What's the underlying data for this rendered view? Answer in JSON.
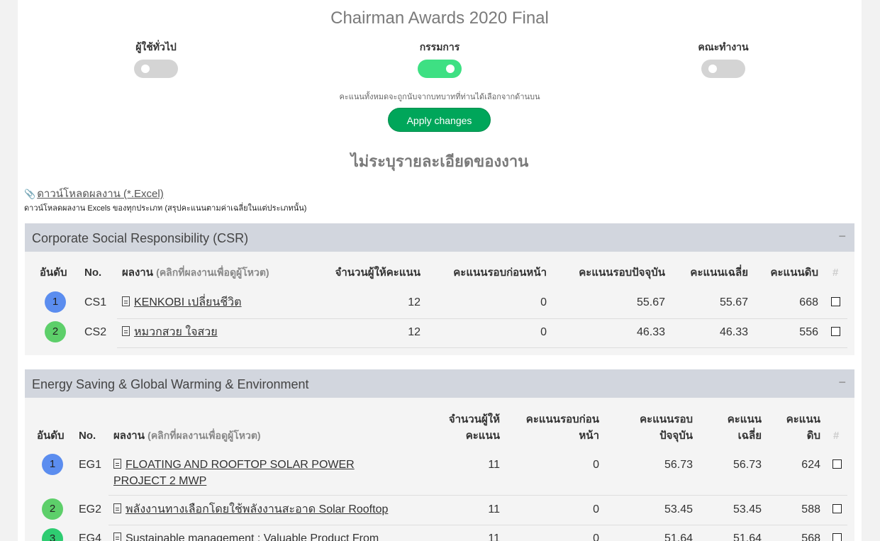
{
  "page": {
    "title": "Chairman Awards 2020 Final",
    "roles": [
      {
        "label": "ผู้ใช้ทั่วไป",
        "on": false
      },
      {
        "label": "กรรมการ",
        "on": true
      },
      {
        "label": "คณะทำงาน",
        "on": false
      }
    ],
    "hint": "คะแนนทั้งหมดจะถูกนับจากบทบาทที่ท่านได้เลือกจากด้านบน",
    "apply_label": "Apply changes",
    "subtitle": "ไม่ระบุรายละเอียดของงาน",
    "download_label": "ดาวน์โหลดผลงาน (*.Excel)",
    "download_desc": "ดาวน์โหลดผลงาน Excels ของทุกประเภท (สรุปคะแนนตามค่าเฉลี่ยในแต่ประเภทนั้น)"
  },
  "csr": {
    "title": "Corporate Social Responsibility (CSR)",
    "collapse": "−",
    "headers": {
      "rank": "อันดับ",
      "no": "No.",
      "work": "ผลงาน",
      "work_note": "(คลิกที่ผลงานเพื่อดูผู้โหวต)",
      "voters": "จำนวนผู้ให้คะแนน",
      "prev": "คะแนนรอบก่อนหน้า",
      "current": "คะแนนรอบปัจจุบัน",
      "avg": "คะแนนเฉลี่ย",
      "raw": "คะแนนดิบ",
      "hash": "#"
    },
    "rows": [
      {
        "rank": "1",
        "no": "CS1",
        "work": "KENKOBI เปลี่ยนชีวิต",
        "voters": "12",
        "prev": "0",
        "current": "55.67",
        "avg": "55.67",
        "raw": "668"
      },
      {
        "rank": "2",
        "no": "CS2",
        "work": "หมวกสวย ใจสวย",
        "voters": "12",
        "prev": "0",
        "current": "46.33",
        "avg": "46.33",
        "raw": "556"
      }
    ]
  },
  "energy": {
    "title": "Energy Saving & Global Warming & Environment",
    "collapse": "−",
    "headers": {
      "rank": "อันดับ",
      "no": "No.",
      "work": "ผลงาน",
      "work_note": "(คลิกที่ผลงานเพื่อดูผู้โหวต)",
      "voters_1": "จำนวนผู้ให้",
      "voters_2": "คะแนน",
      "prev_1": "คะแนนรอบก่อน",
      "prev_2": "หน้า",
      "current_1": "คะแนนรอบ",
      "current_2": "ปัจจุบัน",
      "avg_1": "คะแนน",
      "avg_2": "เฉลี่ย",
      "raw_1": "คะแนน",
      "raw_2": "ดิบ",
      "hash": "#"
    },
    "rows": [
      {
        "rank": "1",
        "no": "EG1",
        "work_1": "FLOATING AND ROOFTOP SOLAR POWER",
        "work_2": "PROJECT 2 MWP",
        "voters": "11",
        "prev": "0",
        "current": "56.73",
        "avg": "56.73",
        "raw": "624"
      },
      {
        "rank": "2",
        "no": "EG2",
        "work_1": "พลังงานทางเลือกโดยใช้พลังงานสะอาด Solar Rooftop",
        "voters": "11",
        "prev": "0",
        "current": "53.45",
        "avg": "53.45",
        "raw": "588"
      },
      {
        "rank": "3",
        "no": "EG4",
        "work_1": "Sustainable management : Valuable Product From",
        "voters": "11",
        "prev": "0",
        "current": "51.64",
        "avg": "51.64",
        "raw": "568"
      }
    ]
  },
  "colors": {
    "rank_1": "#5b8def",
    "rank_2": "#5dcf6a",
    "rank_3": "#2ecc71",
    "toggle_on": "#3ee083",
    "apply": "#00a65a"
  }
}
